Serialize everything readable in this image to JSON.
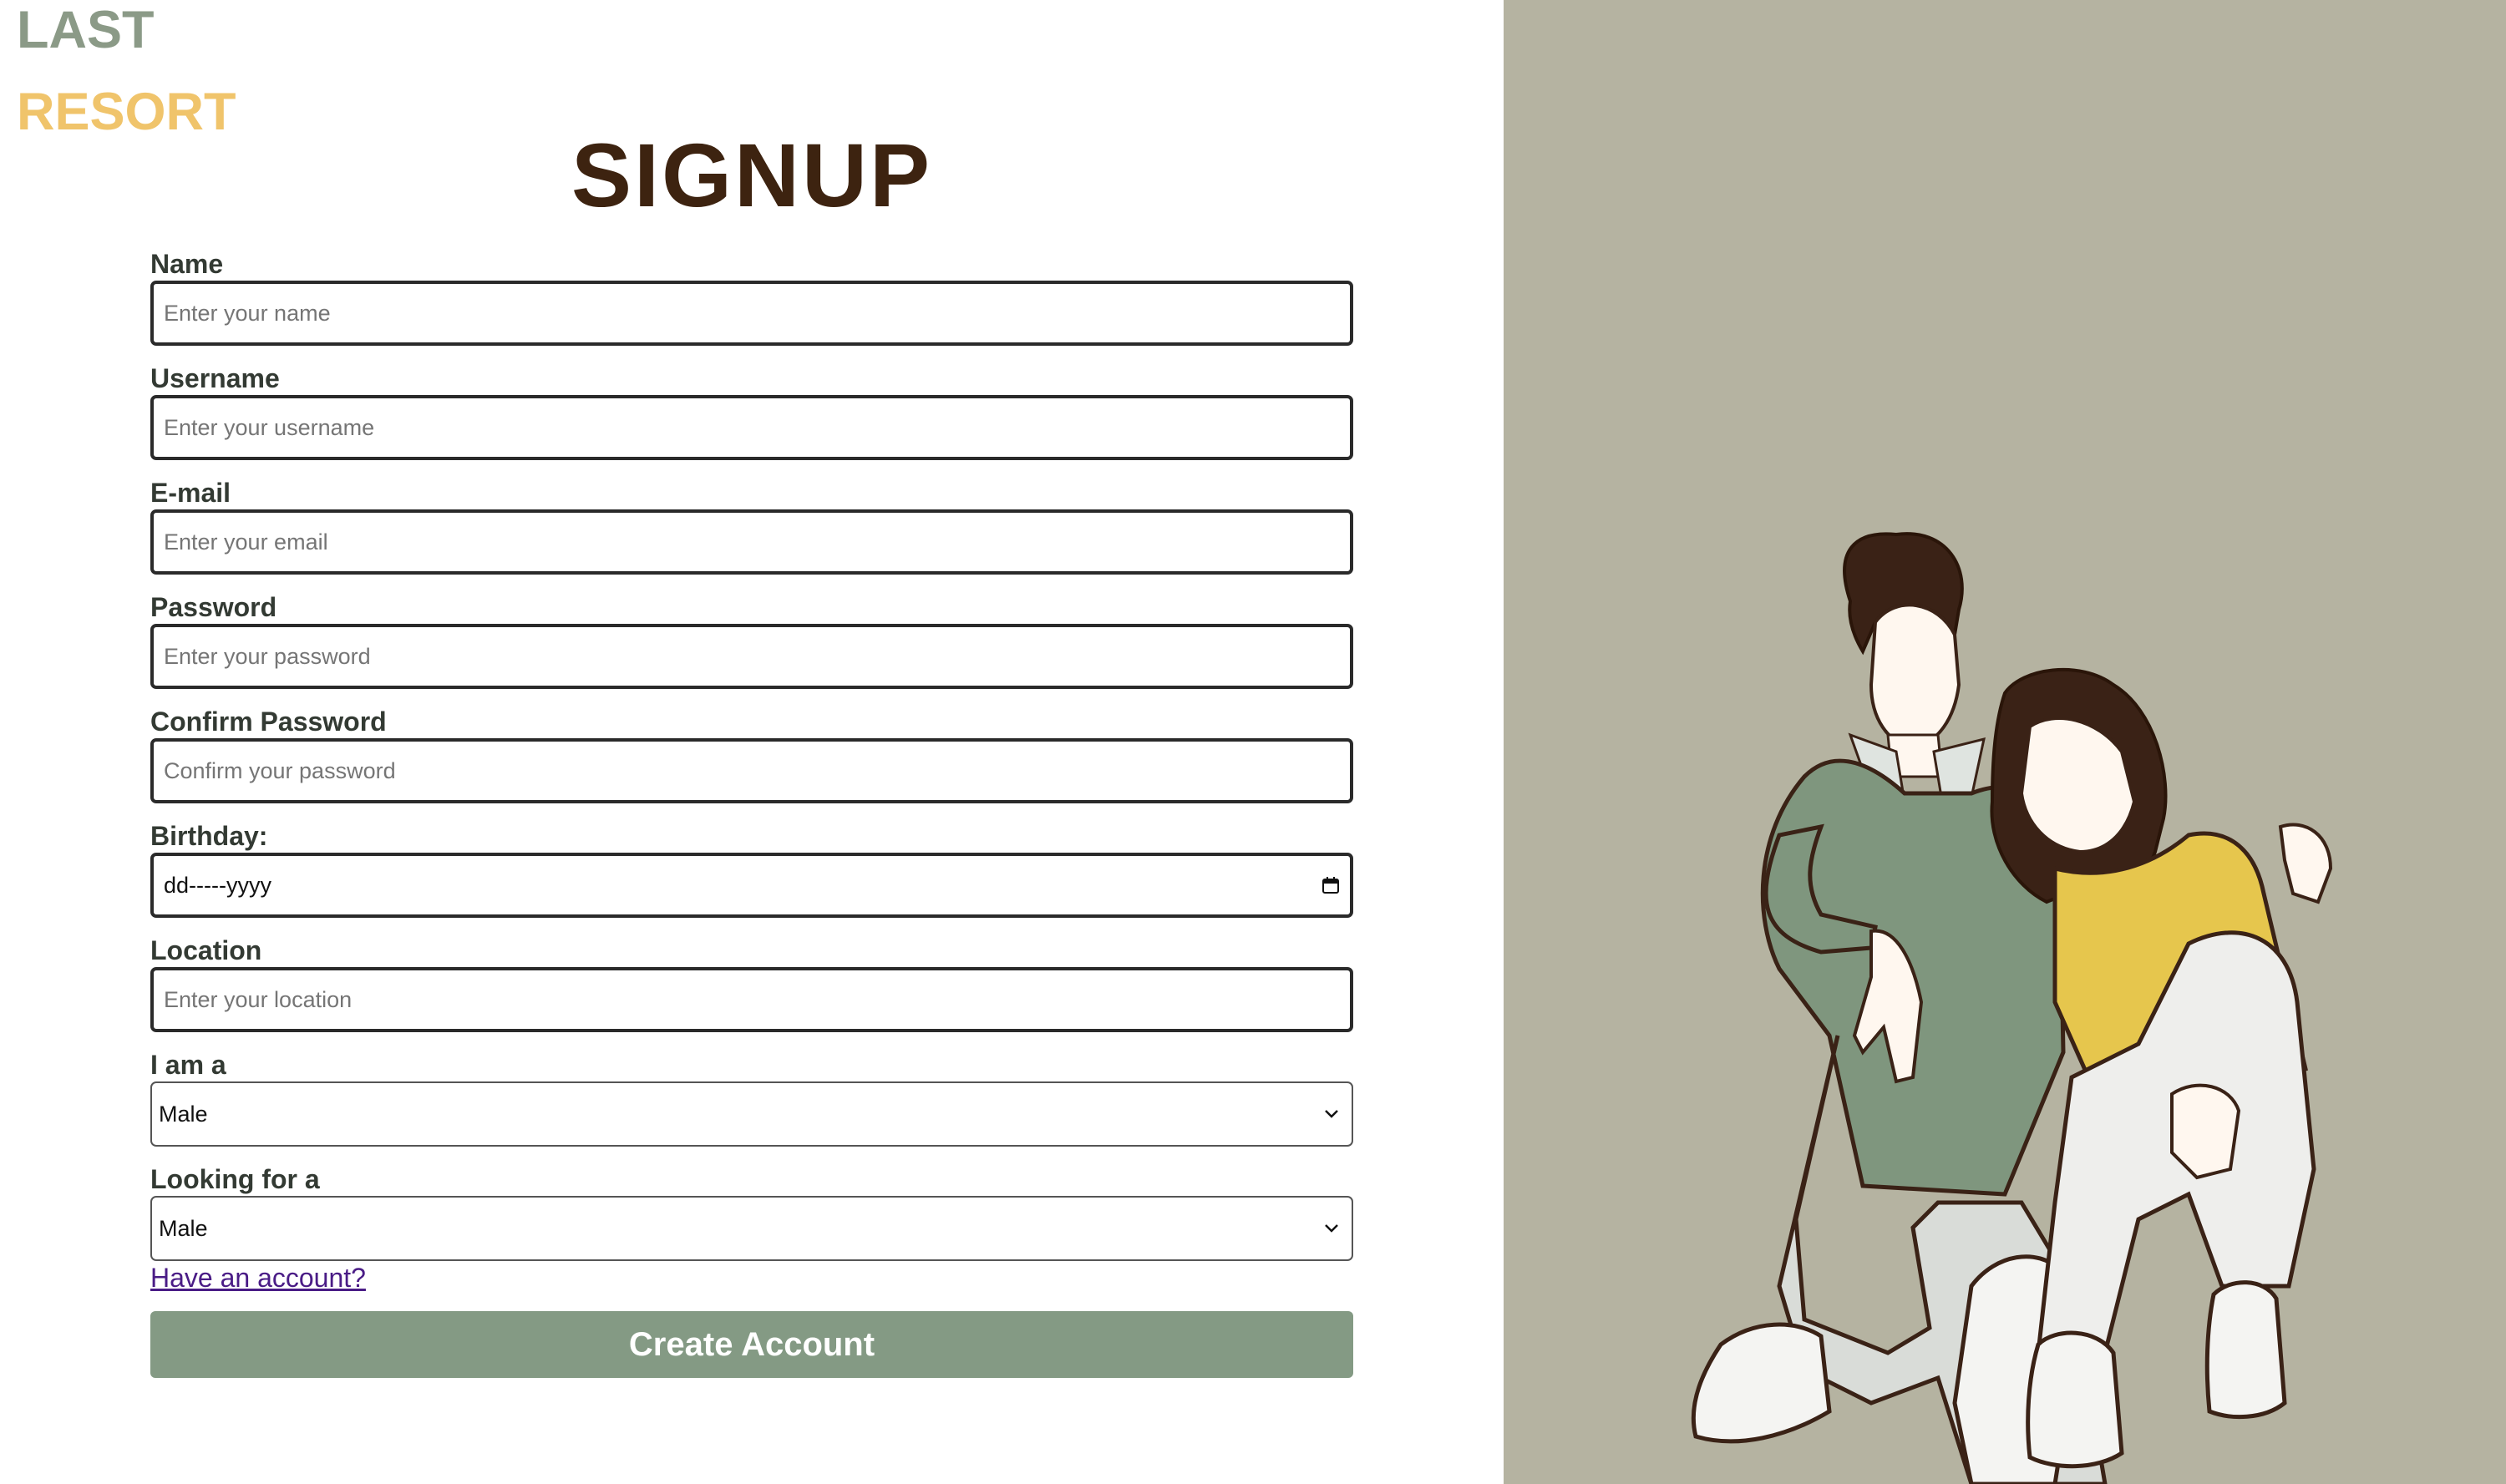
{
  "brand": {
    "line1": "LAST",
    "line2": "RESORT",
    "color_line1": "#8b9a87",
    "color_line2": "#f0c46b"
  },
  "title": "SIGNUP",
  "fields": [
    {
      "label": "Name",
      "placeholder": "Enter your name"
    },
    {
      "label": "Username",
      "placeholder": "Enter your username"
    },
    {
      "label": "E-mail",
      "placeholder": "Enter your email"
    },
    {
      "label": "Password",
      "placeholder": "Enter your password"
    },
    {
      "label": "Confirm Password",
      "placeholder": "Confirm your password"
    }
  ],
  "birthday": {
    "label": "Birthday:",
    "value": "dd-----yyyy",
    "icon": "calendar-icon"
  },
  "location": {
    "label": "Location",
    "placeholder": "Enter your location"
  },
  "i_am": {
    "label": "I am a",
    "selected": "Male",
    "icon": "chevron-down-icon"
  },
  "looking_for": {
    "label": "Looking for a",
    "selected": "Male",
    "icon": "chevron-down-icon"
  },
  "have_account_link": "Have an account?",
  "create_button": "Create Account",
  "colors": {
    "title": "#3d2310",
    "button": "#849a84",
    "right_panel": "#b5b3a1",
    "link": "#4a1c86"
  }
}
